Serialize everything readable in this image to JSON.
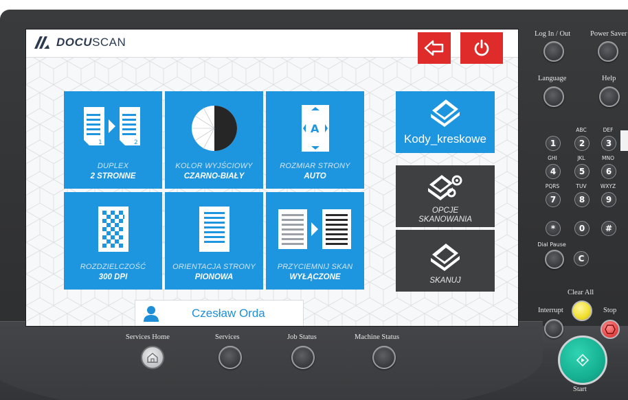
{
  "screen": {
    "logo": {
      "brand": "DOCU",
      "suffix": "SCAN"
    },
    "tiles": [
      {
        "name": "duplex",
        "title": "DUPLEX",
        "value": "2 STRONNE",
        "icon": "duplex-icon"
      },
      {
        "name": "color",
        "title": "KOLOR WYJŚCIOWY",
        "value": "CZARNO-BIAŁY",
        "icon": "color-icon"
      },
      {
        "name": "size",
        "title": "ROZMIAR STRONY",
        "value": "AUTO",
        "icon": "page-size-icon"
      },
      {
        "name": "resolution",
        "title": "ROZDZIELCZOŚĆ",
        "value": "300 DPI",
        "icon": "resolution-icon"
      },
      {
        "name": "orientation",
        "title": "ORIENTACJA STRONY",
        "value": "PIONOWA",
        "icon": "orientation-icon"
      },
      {
        "name": "darken",
        "title": "PRZYCIEMNIJ SKAN",
        "value": "WYŁĄCZONE",
        "icon": "darken-icon"
      }
    ],
    "kody_label": "Kody_kreskowe",
    "opcje_label_1": "OPCJE",
    "opcje_label_2": "SKANOWANIA",
    "skanuj_label": "SKANUJ",
    "user_name": "Czesław Orda",
    "colors": {
      "accent": "#1e96df",
      "red": "#e02b2b",
      "dark_tile": "#3f4042"
    }
  },
  "hardware": {
    "login": "Log In / Out",
    "power_saver": "Power Saver",
    "language": "Language",
    "help": "Help",
    "keypad": [
      {
        "digit": "1",
        "sub": ""
      },
      {
        "digit": "2",
        "sub": "ABC"
      },
      {
        "digit": "3",
        "sub": "DEF"
      },
      {
        "digit": "4",
        "sub": "GHI"
      },
      {
        "digit": "5",
        "sub": "JKL"
      },
      {
        "digit": "6",
        "sub": "MNO"
      },
      {
        "digit": "7",
        "sub": "PQRS"
      },
      {
        "digit": "8",
        "sub": "TUV"
      },
      {
        "digit": "9",
        "sub": "WXYZ"
      },
      {
        "digit": "*",
        "sub": ""
      },
      {
        "digit": "0",
        "sub": ""
      },
      {
        "digit": "#",
        "sub": ""
      }
    ],
    "dial_pause": "Dial Pause",
    "clear_key": "C",
    "clear_all": "Clear All",
    "interrupt": "Interrupt",
    "stop": "Stop",
    "start": "Start",
    "services_home": "Services Home",
    "services": "Services",
    "job_status": "Job Status",
    "machine_status": "Machine Status"
  }
}
